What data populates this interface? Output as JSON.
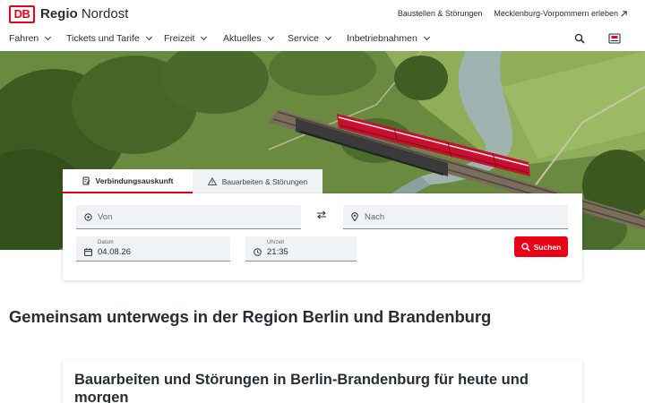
{
  "header": {
    "logo_text": "DB",
    "brand_bold": "Regio",
    "brand_rest": "Nordost",
    "meta_links": [
      {
        "label": "Baustellen & Störungen"
      },
      {
        "label": "Mecklenburg-Vorpommern erleben"
      }
    ]
  },
  "nav": {
    "items": [
      {
        "label": "Fahren"
      },
      {
        "label": "Tickets und Tarife"
      },
      {
        "label": "Freizeit"
      },
      {
        "label": "Aktuelles"
      },
      {
        "label": "Service"
      },
      {
        "label": "Inbetriebnahmen"
      }
    ],
    "icons": [
      "search-icon",
      "ticket-icon"
    ]
  },
  "journey": {
    "tabs": [
      {
        "label": "Verbindungsauskunft",
        "active": true
      },
      {
        "label": "Bauarbeiten & Störungen",
        "active": false
      }
    ],
    "from_placeholder": "Von",
    "to_placeholder": "Nach",
    "date_label": "Datum",
    "date_value": "04.08.26",
    "time_label": "Uhrzeit",
    "time_value": "21:35",
    "search_label": "Suchen"
  },
  "content": {
    "headline": "Gemeinsam unterwegs in der Region Berlin und Brandenburg",
    "card_title": "Bauarbeiten und Störungen in Berlin-Brandenburg für heute und morgen"
  },
  "colors": {
    "brand_red": "#ec0016",
    "text": "#282d37",
    "field_bg": "#f0f3f5"
  }
}
